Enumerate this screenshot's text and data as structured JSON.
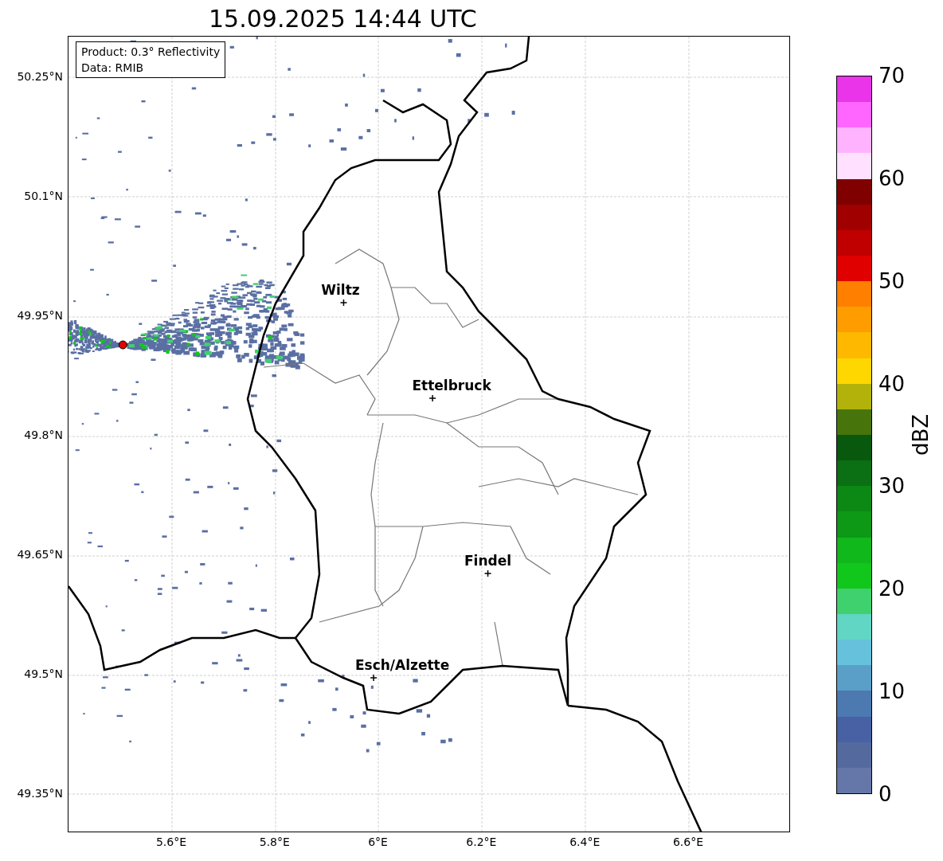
{
  "title": "15.09.2025 14:44 UTC",
  "info_box": {
    "lines": [
      "Product: 0.3° Reflectivity",
      "Data: RMIB"
    ]
  },
  "y_ticks": [
    "50.25°N",
    "50.1°N",
    "49.95°N",
    "49.8°N",
    "49.65°N",
    "49.5°N",
    "49.35°N"
  ],
  "x_ticks": [
    "5.6°E",
    "5.8°E",
    "6°E",
    "6.2°E",
    "6.4°E",
    "6.6°E"
  ],
  "cities": [
    {
      "name": "Wiltz"
    },
    {
      "name": "Ettelbruck"
    },
    {
      "name": "Findel"
    },
    {
      "name": "Esch/Alzette"
    }
  ],
  "colorbar": {
    "label": "dBZ",
    "ticks": [
      "70",
      "60",
      "50",
      "40",
      "30",
      "20",
      "10",
      "0"
    ],
    "segments": [
      {
        "color": "#e934e9"
      },
      {
        "color": "#ff66ff"
      },
      {
        "color": "#ffb3ff"
      },
      {
        "color": "#ffe0ff"
      },
      {
        "color": "#800000"
      },
      {
        "color": "#a00000"
      },
      {
        "color": "#c00000"
      },
      {
        "color": "#e00000"
      },
      {
        "color": "#ff7f00"
      },
      {
        "color": "#ff9c00"
      },
      {
        "color": "#ffb800"
      },
      {
        "color": "#ffd700"
      },
      {
        "color": "#b2b20b"
      },
      {
        "color": "#47750b"
      },
      {
        "color": "#08580d"
      },
      {
        "color": "#0a7013"
      },
      {
        "color": "#0c8815"
      },
      {
        "color": "#0d9816"
      },
      {
        "color": "#11b81b"
      },
      {
        "color": "#12c71c"
      },
      {
        "color": "#3fd16e"
      },
      {
        "color": "#61d6c4"
      },
      {
        "color": "#66c2dc"
      },
      {
        "color": "#5a9fc8"
      },
      {
        "color": "#4b79b0"
      },
      {
        "color": "#4761a4"
      },
      {
        "color": "#546a9f"
      },
      {
        "color": "#6577a8"
      }
    ]
  }
}
